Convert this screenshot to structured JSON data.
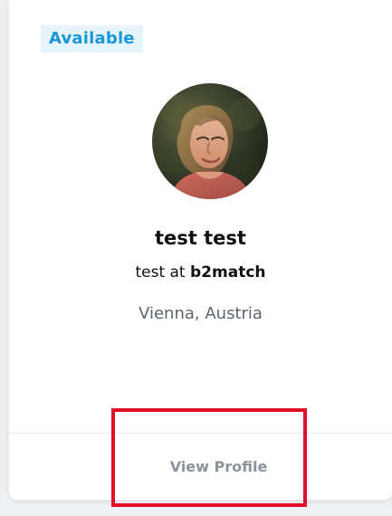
{
  "card": {
    "badge": "Available",
    "name": "test test",
    "role_prefix": "test at ",
    "company": "b2match",
    "location": "Vienna, Austria",
    "view_profile_label": "View Profile"
  },
  "colors": {
    "badge_text": "#1a97d6",
    "badge_bg": "#e7f3fb",
    "highlight": "#e20f2b",
    "muted_text": "#8d939d"
  }
}
